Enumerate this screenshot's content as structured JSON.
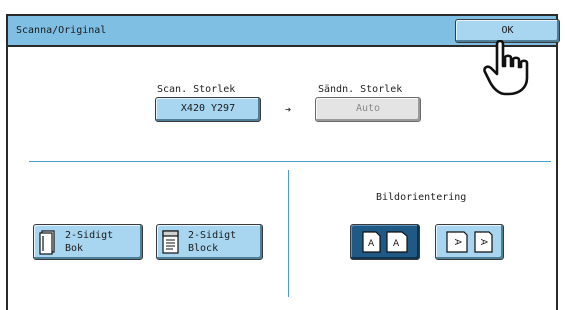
{
  "window": {
    "title": "Scanna/Original"
  },
  "ok_button": {
    "label": "OK"
  },
  "scan_size": {
    "label": "Scan. Storlek",
    "value": "X420  Y297"
  },
  "send_size": {
    "label": "Sändn. Storlek",
    "value": "Auto"
  },
  "arrow": "➜",
  "duplex": {
    "book": {
      "line1": "2-Sidigt",
      "line2": "Bok"
    },
    "tablet": {
      "line1": "2-Sidigt",
      "line2": "Block"
    }
  },
  "orientation": {
    "label": "Bildorientering",
    "options": [
      {
        "name": "portrait-A",
        "glyph": "A",
        "selected": true
      },
      {
        "name": "landscape-A",
        "glyph": "A",
        "selected": false
      }
    ]
  },
  "colors": {
    "accent": "#7fbfe3",
    "button": "#a8d6f1",
    "selected": "#1f5a86",
    "divider": "#4a9fd0"
  }
}
